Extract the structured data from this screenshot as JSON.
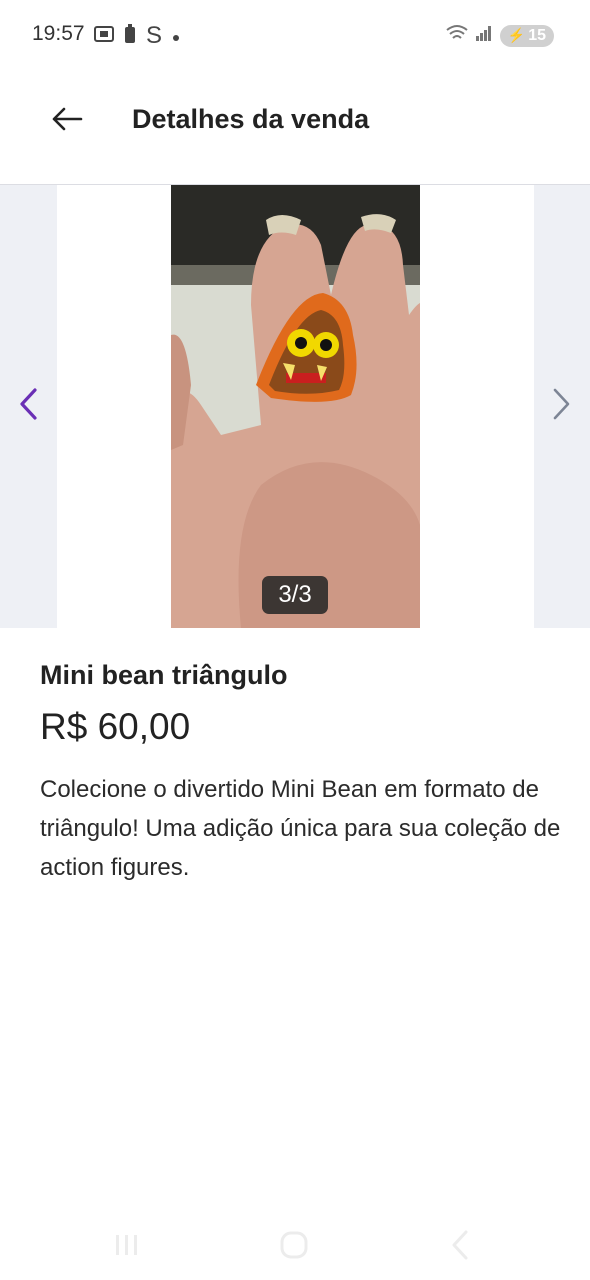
{
  "status_bar": {
    "time": "19:57",
    "left_icons": [
      "screenshot-icon",
      "battery-saver-icon",
      "s-icon",
      "dot-icon"
    ],
    "signal_icons": [
      "wifi-icon",
      "cell-signal-icon"
    ],
    "battery": "15"
  },
  "header": {
    "back_icon": "arrow-left-icon",
    "title": "Detalhes da venda"
  },
  "carousel": {
    "counter": "3/3",
    "prev_icon": "chevron-left-icon",
    "next_icon": "chevron-right-icon",
    "image_subject": "toy-figure-photo"
  },
  "product": {
    "name": "Mini bean triângulo",
    "price": "R$ 60,00",
    "description": "Colecione o divertido Mini Bean em formato de triângulo! Uma adição única para sua coleção de action figures."
  },
  "system_nav": {
    "icons": [
      "recents-icon",
      "home-icon",
      "back-icon"
    ]
  },
  "colors": {
    "accent_purple": "#6a2fb5",
    "chevron_gray": "#7d8595",
    "side_panel": "#eef0f5",
    "divider": "#dcdde3"
  }
}
